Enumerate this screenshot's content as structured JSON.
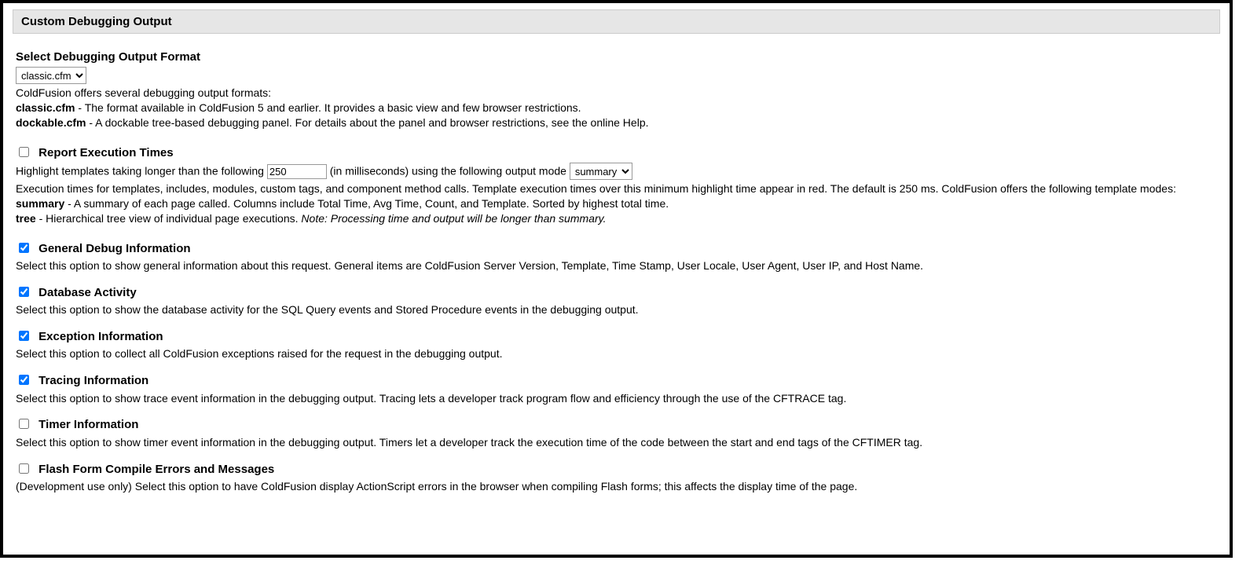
{
  "header": {
    "title": "Custom Debugging Output"
  },
  "format": {
    "heading": "Select Debugging Output Format",
    "selected": "classic.cfm",
    "intro": "ColdFusion offers several debugging output formats:",
    "classic_name": "classic.cfm",
    "classic_desc": " - The format available in ColdFusion 5 and earlier. It provides a basic view and few browser restrictions.",
    "dockable_name": "dockable.cfm",
    "dockable_desc": " - A dockable tree-based debugging panel. For details about the panel and browser restrictions, see the online Help."
  },
  "reportExec": {
    "heading": "Report Execution Times",
    "pre": "Highlight templates taking longer than the following   ",
    "threshold_value": "250",
    "mid": " (in milliseconds) using the following output mode ",
    "mode_selected": "summary",
    "desc1": "Execution times for templates, includes, modules, custom tags, and component method calls. Template execution times over this minimum highlight time appear in red. The default is 250 ms. ColdFusion offers the following template modes:",
    "summary_name": "summary",
    "summary_desc": " - A summary of each page called. Columns include Total Time, Avg Time, Count, and Template. Sorted by highest total time.",
    "tree_name": "tree",
    "tree_desc_plain": " - Hierarchical tree view of individual page executions. ",
    "tree_desc_italic": "Note: Processing time and output will be longer than summary."
  },
  "general": {
    "heading": "General Debug Information",
    "desc": "Select this option to show general information about this request. General items are ColdFusion Server Version, Template, Time Stamp, User Locale, User Agent, User IP, and Host Name."
  },
  "database": {
    "heading": "Database Activity",
    "desc": "Select this option to show the database activity for the SQL Query events and Stored Procedure events in the debugging output."
  },
  "exception": {
    "heading": "Exception Information",
    "desc": "Select this option to collect all ColdFusion exceptions raised for the request in the debugging output."
  },
  "tracing": {
    "heading": "Tracing Information",
    "desc": "Select this option to show trace event information in the debugging output. Tracing lets a developer track program flow and efficiency through the use of the CFTRACE tag."
  },
  "timer": {
    "heading": "Timer Information",
    "desc": "Select this option to show timer event information in the debugging output. Timers let a developer track the execution time of the code between the start and end tags of the CFTIMER tag."
  },
  "flash": {
    "heading": "Flash Form Compile Errors and Messages",
    "desc": "(Development use only) Select this option to have ColdFusion display ActionScript errors in the browser when compiling Flash forms; this affects the display time of the page."
  }
}
